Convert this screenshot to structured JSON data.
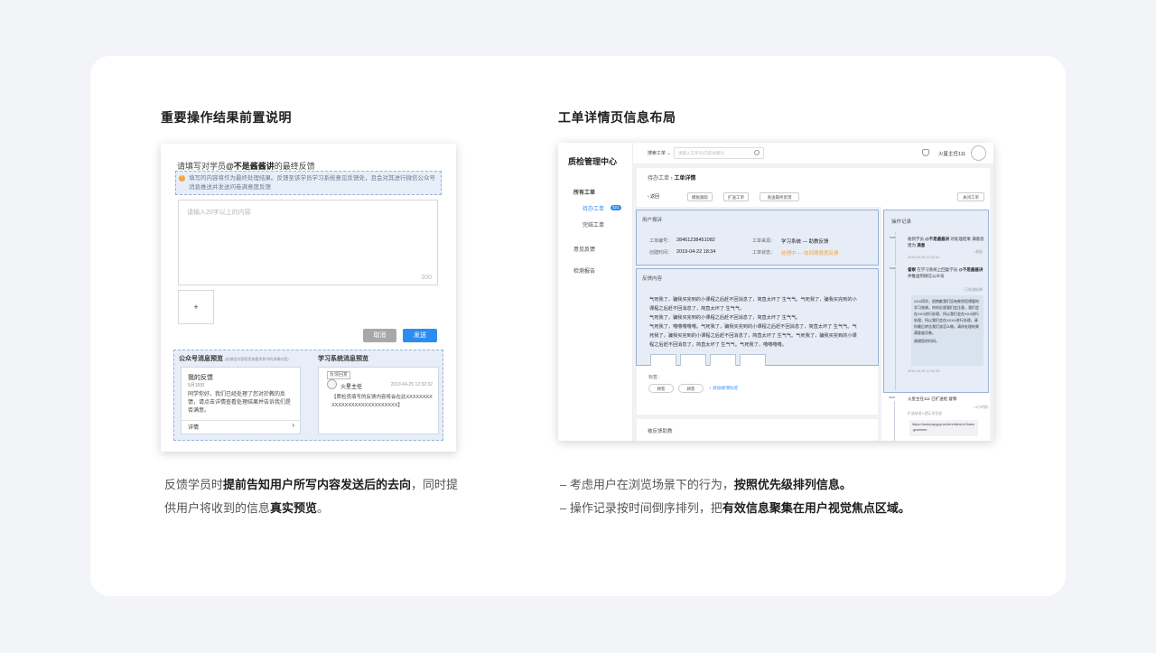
{
  "left_section": {
    "title": "重要操作结果前置说明",
    "form": {
      "heading_prefix": "请填写对学员",
      "heading_name": "@不是酱酱讲",
      "heading_suffix": "的最终反馈",
      "tip": "填写的内容将作为最终处理结果。反馈至该学员学习系统意见反馈处，且会对其进行微信公众号消息推送并发送问卷满意度反馈",
      "textarea_placeholder": "请输入20字以上的内容",
      "char_count": "200",
      "upload_symbol": "+",
      "cancel_label": "取消",
      "send_label": "发送"
    },
    "preview": {
      "wechat_title": "公众号消息预览",
      "wechat_note": "(在微信内容框里查看消息中的详情内容)",
      "wechat_card": {
        "title": "我的反馈",
        "date": "5月19日",
        "body": "同学你好，我们已经处理了您对於教的反馈，请点击详情查看处理结果并告诉我们是否满意。",
        "link_label": "详情",
        "arrow": "›"
      },
      "system_title": "学习系统消息预览",
      "system_card": {
        "tag": "反馈回复",
        "sender": "火星主任",
        "time": "2019-04-25  12:32:32",
        "body": "【质检员填写的反馈内容将会在此XXXXXXXXXXXXXXXXXXXXXXXXXXXX】"
      }
    },
    "caption_parts": [
      "反馈学员时",
      "提前告知用户所写内容发送后的去向",
      "，同时提供用户将收到的信息",
      "真实预览",
      "。"
    ]
  },
  "right_section": {
    "title": "工单详情页信息布局",
    "app": {
      "brand": "质检管理中心",
      "nav": {
        "all_orders": "所有工单",
        "pending": "待办工单",
        "pending_badge": "321",
        "done": "完结工单",
        "feedback": "意见反馈",
        "report": "检测报告"
      },
      "topbar": {
        "search_type": "搜索工单 ⌄",
        "search_placeholder": "请输入工单号/内容关键词",
        "user": "火星主任111"
      },
      "breadcrumb_parent": "待办工单",
      "breadcrumb_sep": "›",
      "breadcrumb_current": "工单详情",
      "toolbar": {
        "back": "‹ 返回",
        "b1": "模板跟踪",
        "b2": "扩送工单",
        "b3": "发送最终反馈",
        "close": "关闭工单"
      },
      "user_report": {
        "title": "用户报诉",
        "order_no_label": "工单编号：",
        "order_no": "28461238451082",
        "created_label": "创建时间：",
        "created": "2019-04-22  18:34",
        "source_label": "工单来源：",
        "source": "学习系统 — 助教反馈",
        "status_label": "工单状态：",
        "status": "处理中 — 收到满意度反馈"
      },
      "feedback": {
        "title": "反馈内容",
        "lines": [
          "气死我了，骗我买完到的小课程之后赶不回消息了，简直太坏了 生气气。气死我了，骗我买完到的小",
          "课程之后赶不回消息了，简直太坏了 生气气。",
          "气死我了，骗我买完到的小课程之后赶不回消息了，简直太坏了 生气气。",
          "气死我了，噜噜噜噜噜。气死我了，骗我买完到的小课程之后赶不回消息了，简直太坏了 生气气。气",
          "死我了，骗我买完到的小课程之后赶不回消息了，简直太坏了 生气气。气死我了，骗我买完到的小课",
          "程之后赶不回消息了，简直太坏了 生气气。气死我了，噜噜噜噜。"
        ],
        "tags_label": "标签：",
        "tag1": "顾客",
        "tag2": "顾客",
        "add_tag": "+ 添加/新增标签"
      },
      "bottom_section": "被反馈助教",
      "log": {
        "title": "操作记录",
        "e1_icon": "icon",
        "e1_a": "收到学员",
        "e1_name": "@不是酱酱讲",
        "e1_b": "对处理结果",
        "e1_c": "满意反馈为",
        "e1_result": "满意",
        "e1_time": "2019-04-26  12:32:32",
        "e1_more": "› 收起",
        "e2_icon": "icon",
        "e2_who": "督察",
        "e2_a": "在学习系统上回复学员",
        "e2_name": "@不是酱酱讲",
        "e2_b": "并推送到微信公众号",
        "e2_more": "› 已处理结果",
        "e2_msg": "XXX同学，很抱歉我们没有做到您想要的学习效果。你的反馈我们会注意，我们会在XXX进行处理，所以我们会在XXX进行处理，所以我们会在XXXX进行处理，请你最后转告我们该怎么做。请你处理结果满意度问卷。",
        "e2_thanks": "谢谢您的时间。",
        "e2_time": "2019-04-26  12:32:33",
        "e3_icon": "icon",
        "e3_text": "火星主任111 已扩送给 督察",
        "e3_more": "› 4小时前",
        "e3_reason": "扩送给进入提示学员说",
        "e3_link": "https://www.pspypy.cn/kereinline/c1/base-grammer"
      }
    },
    "bullets": [
      {
        "dash": "–",
        "normal": "考虑用户在浏览场景下的行为，",
        "bold": "按照优先级排列信息",
        "end": "。"
      },
      {
        "dash": "–",
        "normal": "操作记录按时间倒序排列，把",
        "bold": "有效信息聚集在用户视觉焦点区域",
        "end": "。"
      }
    ]
  },
  "colors": {
    "page_bg": "#f3f4f8",
    "accent_blue": "#2c8df0",
    "highlight_bg": "#e6edf7",
    "highlight_border": "#9ab1d6",
    "status_orange": "#f2a43a"
  }
}
